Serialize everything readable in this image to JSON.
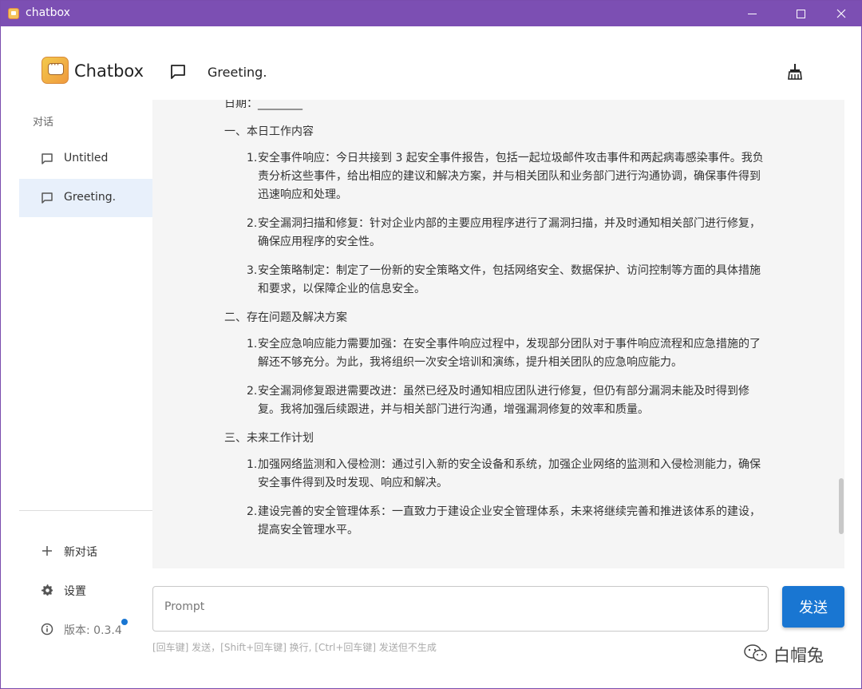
{
  "window": {
    "title": "chatbox"
  },
  "sidebar": {
    "brand": "Chatbox",
    "section_label": "对话",
    "conversations": [
      {
        "label": "Untitled",
        "active": false
      },
      {
        "label": "Greeting.",
        "active": true
      }
    ],
    "new_chat_label": "新对话",
    "settings_label": "设置",
    "version_label": "版本: 0.3.4"
  },
  "header": {
    "title": "Greeting."
  },
  "message": {
    "date_line": "日期：________",
    "sections": [
      {
        "heading": "一、本日工作内容",
        "items": [
          {
            "num": "1.",
            "text": "安全事件响应：今日共接到 3 起安全事件报告，包括一起垃圾邮件攻击事件和两起病毒感染事件。我负责分析这些事件，给出相应的建议和解决方案，并与相关团队和业务部门进行沟通协调，确保事件得到迅速响应和处理。"
          },
          {
            "num": "2.",
            "text": "安全漏洞扫描和修复：针对企业内部的主要应用程序进行了漏洞扫描，并及时通知相关部门进行修复，确保应用程序的安全性。"
          },
          {
            "num": "3.",
            "text": "安全策略制定：制定了一份新的安全策略文件，包括网络安全、数据保护、访问控制等方面的具体措施和要求，以保障企业的信息安全。"
          }
        ]
      },
      {
        "heading": "二、存在问题及解决方案",
        "items": [
          {
            "num": "1.",
            "text": "安全应急响应能力需要加强：在安全事件响应过程中，发现部分团队对于事件响应流程和应急措施的了解还不够充分。为此，我将组织一次安全培训和演练，提升相关团队的应急响应能力。"
          },
          {
            "num": "2.",
            "text": "安全漏洞修复跟进需要改进：虽然已经及时通知相应团队进行修复，但仍有部分漏洞未能及时得到修复。我将加强后续跟进，并与相关部门进行沟通，增强漏洞修复的效率和质量。"
          }
        ]
      },
      {
        "heading": "三、未来工作计划",
        "items": [
          {
            "num": "1.",
            "text": "加强网络监测和入侵检测：通过引入新的安全设备和系统，加强企业网络的监测和入侵检测能力，确保安全事件得到及时发现、响应和解决。"
          },
          {
            "num": "2.",
            "text": "建设完善的安全管理体系：一直致力于建设企业安全管理体系，未来将继续完善和推进该体系的建设，提高安全管理水平。"
          }
        ]
      }
    ]
  },
  "input": {
    "placeholder": "Prompt",
    "value": ""
  },
  "send_label": "发送",
  "hint": "[回车键] 发送，[Shift+回车键] 换行, [Ctrl+回车键] 发送但不生成",
  "watermark": "白帽兔",
  "colors": {
    "titlebar": "#7c4fb3",
    "accent": "#1976d2",
    "active_item": "#e8f0fb"
  }
}
